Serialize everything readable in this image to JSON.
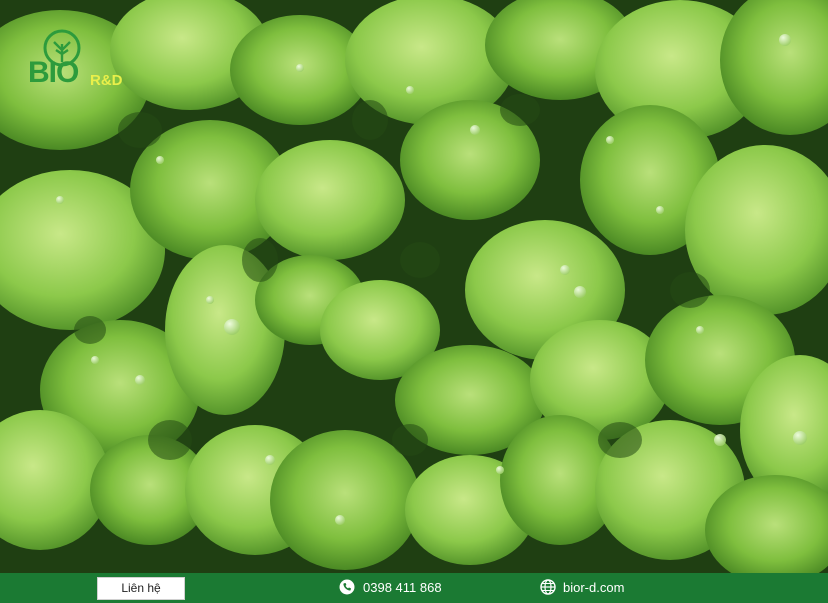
{
  "brand": {
    "logo_main": "BIO",
    "logo_sub": "R&D",
    "accent": "#2d9b3c",
    "sub_color": "#e9ef4a"
  },
  "photo": {
    "subject": "lettuce-leaves-icon"
  },
  "footer": {
    "background": "#1b7a33",
    "contact_label": "Liên hệ",
    "phone_icon": "phone-icon",
    "phone": "0398 411 868",
    "web_icon": "globe-icon",
    "website": "bior-d.com"
  }
}
